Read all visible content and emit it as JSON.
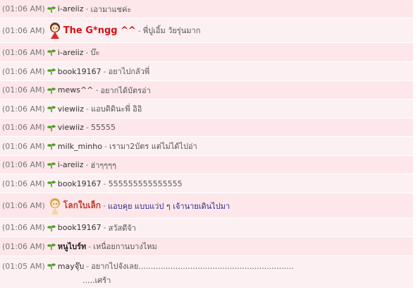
{
  "messages": [
    {
      "time": "(01:06 AM)",
      "user": "i-areiiz",
      "text": "เอามาแชค่ะ"
    },
    {
      "time": "(01:06 AM)",
      "user": "The G*ngg ^^",
      "text": "พี่ปูเอิ้ม วัยรุ่นมาก"
    },
    {
      "time": "(01:06 AM)",
      "user": "i-areiiz",
      "text": "บ๊ะ"
    },
    {
      "time": "(01:06 AM)",
      "user": "book19167",
      "text": "อยาไปกลัวพี่"
    },
    {
      "time": "(01:06 AM)",
      "user": "mews^^",
      "text": "อยากได้บัตรอ่า"
    },
    {
      "time": "(01:06 AM)",
      "user": "viewiiz",
      "text": "แอบดิดินะพี่ อิอิ"
    },
    {
      "time": "(01:06 AM)",
      "user": "viewiiz",
      "text": "55555"
    },
    {
      "time": "(01:06 AM)",
      "user": "milk_minho",
      "text": "เรามา2บัตร แต่ไม่ได้ไปอ่า"
    },
    {
      "time": "(01:06 AM)",
      "user": "i-areiiz",
      "text": "ฮ่าๆๆๆๆ"
    },
    {
      "time": "(01:06 AM)",
      "user": "book19167",
      "text": "555555555555555"
    },
    {
      "time": "(01:06 AM)",
      "user": "โลกใบเล็ก",
      "text": "แอบคุย แบบแว่ป ๆ เจ้านายเดินไปมา"
    },
    {
      "time": "(01:06 AM)",
      "user": "book19167",
      "text": "สวัสดีจ้า"
    },
    {
      "time": "(01:06 AM)",
      "user": "หนูไบร์ท",
      "text": "เหนื่อยกานบางไหม"
    },
    {
      "time": "(01:05 AM)",
      "user": "mayจุ๊บ",
      "text": "อยากไปจังเลย...............................................................",
      "text2": ".....เศร้า"
    }
  ],
  "separator": "-",
  "colors": {
    "row_odd": "#fde7ea",
    "row_even": "#fdf0f2",
    "sprout": "#3f8f1a"
  }
}
